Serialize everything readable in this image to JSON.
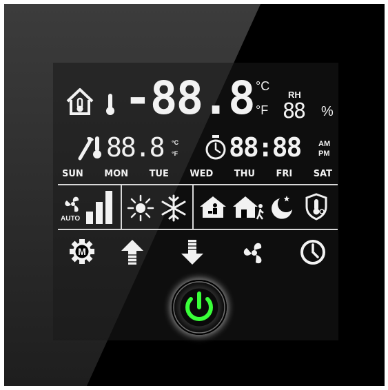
{
  "display": {
    "room_temp": "-88.8",
    "unit_c": "°C",
    "unit_f": "°F",
    "rh_label": "RH",
    "rh_value": "88",
    "rh_unit": "%",
    "set_temp": "88.8",
    "set_unit_c": "°C",
    "set_unit_f": "°F",
    "clock": "88:88",
    "am": "AM",
    "pm": "PM"
  },
  "days": [
    "SUN",
    "MON",
    "TUE",
    "WED",
    "THU",
    "FRI",
    "SAT"
  ],
  "fan": {
    "auto_label": "AUTO"
  },
  "colors": {
    "segment": "#f2f2f2",
    "power_ring": "#39ff39",
    "background": "#000000"
  },
  "icons": {
    "row1": [
      "house-thermometer-icon",
      "thermometer-icon"
    ],
    "row2": [
      "wrench-thermometer-icon",
      "timer-icon"
    ],
    "modes": [
      "fan-auto-icon",
      "fan-speed-bars-icon",
      "sun-heating-icon",
      "snowflake-cooling-icon",
      "home-occupied-icon",
      "away-icon",
      "night-mode-icon",
      "frost-protect-icon"
    ],
    "buttons": [
      "mode-m-button",
      "up-arrow-button",
      "down-arrow-button",
      "fan-button",
      "clock-button",
      "power-button"
    ]
  }
}
